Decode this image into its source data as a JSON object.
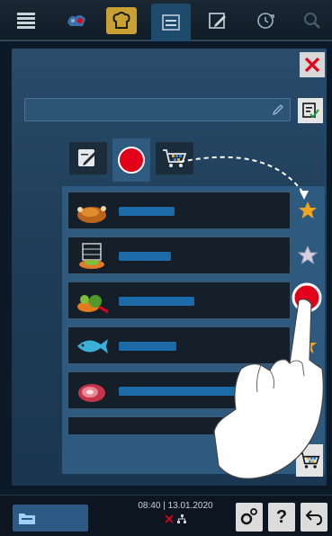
{
  "topbar": {
    "tabs": [
      {
        "icon": "menu-icon"
      },
      {
        "icon": "intelligent-cooking-icon"
      },
      {
        "icon": "chef-hat-icon"
      },
      {
        "icon": "programs-list-icon"
      },
      {
        "icon": "edit-program-icon"
      },
      {
        "icon": "refresh-icon"
      },
      {
        "icon": "search-icon"
      }
    ]
  },
  "panel": {
    "search": {
      "placeholder": ""
    },
    "subtabs": [
      {
        "icon": "edit-icon"
      },
      {
        "icon": "record-dot-icon"
      },
      {
        "icon": "shopping-cart-icon"
      }
    ],
    "rows": [
      {
        "icon": "roast-chicken-icon",
        "label": "",
        "favorite": true
      },
      {
        "icon": "stacked-dishes-icon",
        "label": "",
        "favorite": false
      },
      {
        "icon": "vegetables-icon",
        "label": "",
        "favorite": true
      },
      {
        "icon": "fish-icon",
        "label": "",
        "favorite": true
      },
      {
        "icon": "meat-icon",
        "label": "",
        "favorite": true
      }
    ]
  },
  "bottombar": {
    "time": "08:40",
    "date": "13.01.2020",
    "help_label": "?"
  },
  "colors": {
    "accent": "#2f5a7f",
    "red": "#e2001a",
    "star": "#f2a41c"
  }
}
